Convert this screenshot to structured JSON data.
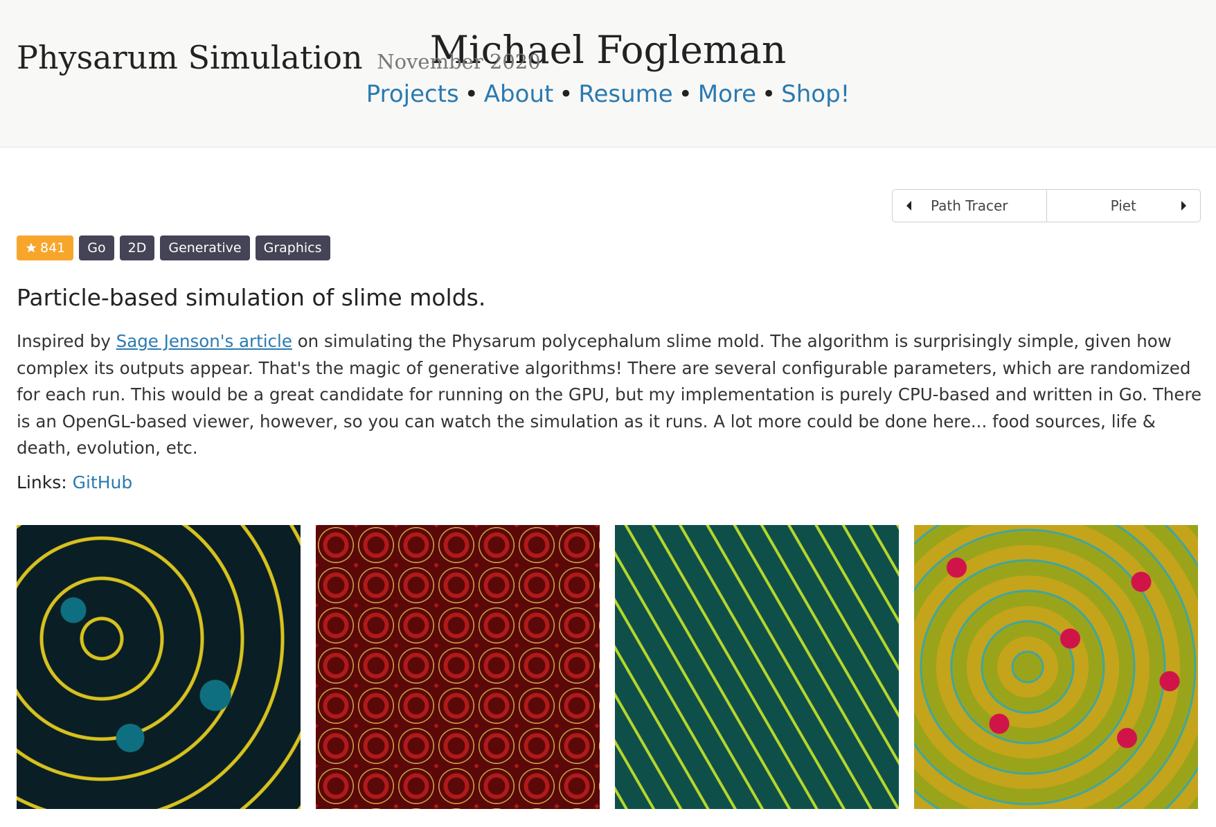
{
  "site": {
    "title": "Michael Fogleman",
    "nav": [
      "Projects",
      "About",
      "Resume",
      "More",
      "Shop!"
    ],
    "nav_separator": "•"
  },
  "project": {
    "title": "Physarum Simulation",
    "date": "November 2020",
    "stars": "841",
    "star_icon": "star-icon",
    "tags": [
      "Go",
      "2D",
      "Generative",
      "Graphics"
    ],
    "summary": "Particle-based simulation of slime molds.",
    "body_prefix": "Inspired by ",
    "body_link": "Sage Jenson's article",
    "body_suffix": " on simulating the Physarum polycephalum slime mold. The algorithm is surprisingly simple, given how complex its outputs appear. That's the magic of generative algorithms! There are several configurable parameters, which are randomized for each run. This would be a great candidate for running on the GPU, but my implementation is purely CPU-based and written in Go. There is an OpenGL-based viewer, however, so you can watch the simulation as it runs. A lot more could be done here... food sources, life & death, evolution, etc.",
    "links_label": "Links:",
    "links": [
      "GitHub"
    ]
  },
  "pager": {
    "prev_label": "Path Tracer",
    "next_label": "Piet"
  },
  "colors": {
    "link": "#2a7ab0",
    "tag_bg": "#444456",
    "stars_bg": "#f7a62b",
    "header_bg": "#f8f8f7"
  }
}
